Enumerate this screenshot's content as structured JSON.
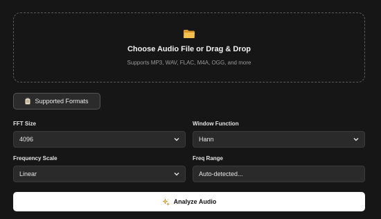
{
  "dropzone": {
    "title": "Choose Audio File or Drag & Drop",
    "subtitle": "Supports MP3, WAV, FLAC, M4A, OGG, and more",
    "icon": "folder-icon"
  },
  "formats_button": {
    "label": "Supported Formats",
    "icon": "clipboard-icon"
  },
  "controls": {
    "fft_size": {
      "label": "FFT Size",
      "value": "4096"
    },
    "window_function": {
      "label": "Window Function",
      "value": "Hann"
    },
    "frequency_scale": {
      "label": "Frequency Scale",
      "value": "Linear"
    },
    "freq_range": {
      "label": "Freq Range",
      "value": "Auto-detected..."
    }
  },
  "analyze_button": {
    "label": "Analyze Audio",
    "icon": "sparkle-icon"
  },
  "colors": {
    "background": "#161616",
    "field": "#2a2a2a",
    "accent": "#f5c542"
  }
}
